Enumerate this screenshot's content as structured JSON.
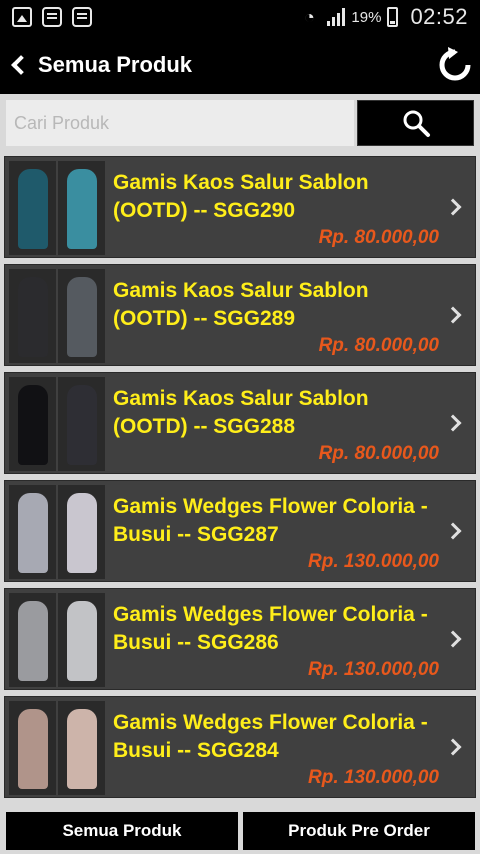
{
  "status_bar": {
    "notification_icons": [
      "image-icon",
      "chat-icon",
      "chat-icon"
    ],
    "battery_percent": "19%",
    "time": "02:52"
  },
  "header": {
    "title": "Semua Produk",
    "back_icon": "chevron-left-icon",
    "refresh_icon": "refresh-icon"
  },
  "search": {
    "placeholder": "Cari Produk",
    "value": "",
    "button_icon": "search-icon"
  },
  "products": [
    {
      "title": "Gamis Kaos Salur Sablon (OOTD) -- SGG290",
      "price": "Rp. 80.000,00",
      "dress_color": "#1f5a6b",
      "accent_color": "#3a8ea0"
    },
    {
      "title": "Gamis Kaos Salur Sablon (OOTD) -- SGG289",
      "price": "Rp. 80.000,00",
      "dress_color": "#2b2b2e",
      "accent_color": "#555a60"
    },
    {
      "title": "Gamis Kaos Salur Sablon (OOTD) -- SGG288",
      "price": "Rp. 80.000,00",
      "dress_color": "#111114",
      "accent_color": "#2e2e34"
    },
    {
      "title": "Gamis Wedges Flower Coloria - Busui -- SGG287",
      "price": "Rp. 130.000,00",
      "dress_color": "#a7a9b3",
      "accent_color": "#c9c6cf"
    },
    {
      "title": "Gamis Wedges Flower Coloria - Busui -- SGG286",
      "price": "Rp. 130.000,00",
      "dress_color": "#9a9b9f",
      "accent_color": "#c2c3c6"
    },
    {
      "title": "Gamis Wedges Flower Coloria - Busui -- SGG284",
      "price": "Rp. 130.000,00",
      "dress_color": "#b0948a",
      "accent_color": "#cdb4aa"
    }
  ],
  "bottom_tabs": {
    "left": "Semua Produk",
    "right": "Produk Pre Order"
  },
  "colors": {
    "title_yellow": "#ffee1a",
    "price_orange": "#e8581c",
    "card_bg": "#404040"
  }
}
